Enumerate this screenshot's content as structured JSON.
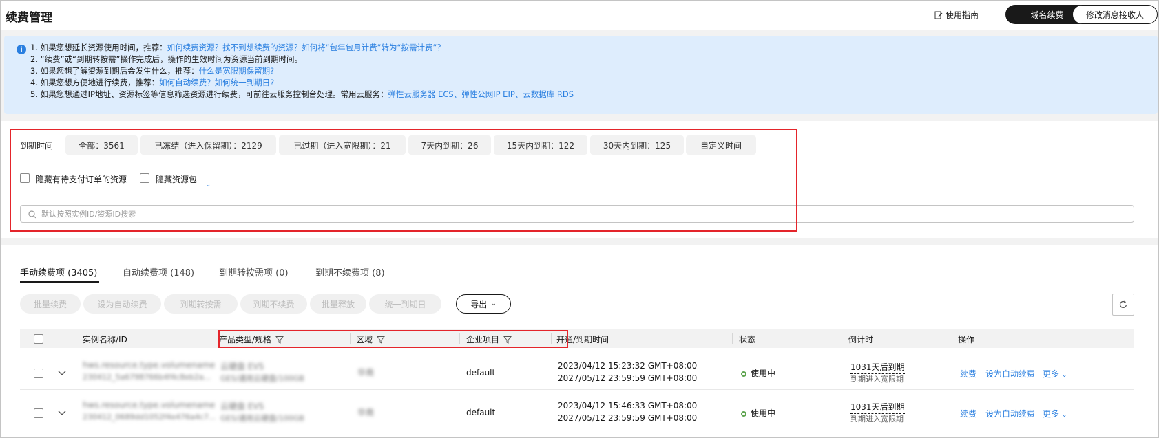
{
  "header": {
    "title": "续费管理",
    "guide_label": "使用指南",
    "domain_renew_label": "域名续费",
    "modify_receiver_label": "修改消息接收人"
  },
  "tips": [
    {
      "text": "1. 如果您想延长资源使用时间，推荐：",
      "link": "如何续费资源？找不到想续费的资源？如何将“包年包月计费”转为“按需计费”？"
    },
    {
      "text": "2. “续费”或“到期转按需”操作完成后，操作的生效时间为资源当前到期时间。",
      "link": ""
    },
    {
      "text": "3. 如果您想了解资源到期后会发生什么，推荐：",
      "link": "什么是宽限期保留期?"
    },
    {
      "text": "4. 如果您想方便地进行续费，推荐：",
      "link": "如何自动续费？如何统一到期日?"
    },
    {
      "text": "5. 如果您想通过IP地址、资源标签等信息筛选资源进行续费，可前往云服务控制台处理。常用云服务：",
      "link": "弹性云服务器 ECS、弹性公网IP EIP、云数据库 RDS"
    }
  ],
  "filter": {
    "label": "到期时间",
    "chips": [
      "全部：3561",
      "已冻结（进入保留期）：2129",
      "已过期（进入宽限期）：21",
      "7天内到期：26",
      "15天内到期：122",
      "30天内到期：125",
      "自定义时间"
    ],
    "hide_pending_label": "隐藏有待支付订单的资源",
    "hide_package_label": "隐藏资源包",
    "search_placeholder": "默认按照实例ID/资源ID搜索"
  },
  "tabs": [
    "手动续费项 (3405)",
    "自动续费项 (148)",
    "到期转按需项 (0)",
    "到期不续费项 (8)"
  ],
  "actions": {
    "buttons": [
      "批量续费",
      "设为自动续费",
      "到期转按需",
      "到期不续费",
      "批量释放",
      "统一到期日"
    ],
    "export_label": "导出"
  },
  "table": {
    "columns": [
      "实例名称/ID",
      "产品类型/规格",
      "区域",
      "企业项目",
      "开通/到期时间",
      "状态",
      "倒计时",
      "操作"
    ],
    "rows": [
      {
        "name": "hws.resource.type.volumename",
        "id": "230412_5a6798766b4f4c8eb2a...",
        "product": "云硬盘 EVS",
        "spec": "GES/通用云硬盘/100GB",
        "region": "华南",
        "project": "default",
        "opened": "2023/04/12 15:23:32 GMT+08:00",
        "expires": "2027/05/12 23:59:59 GMT+08:00",
        "status": "使用中",
        "countdown": "1031天后到期",
        "countdown_sub": "到期进入宽限期",
        "op_renew": "续费",
        "op_auto": "设为自动续费",
        "op_more": "更多"
      },
      {
        "name": "hws.resource.type.volumename",
        "id": "230412_0689dd1052f4e476a4c7...",
        "product": "云硬盘 EVS",
        "spec": "GES/通用云硬盘/100GB",
        "region": "华南",
        "project": "default",
        "opened": "2023/04/12 15:46:33 GMT+08:00",
        "expires": "2027/05/12 23:59:59 GMT+08:00",
        "status": "使用中",
        "countdown": "1031天后到期",
        "countdown_sub": "到期进入宽限期",
        "op_renew": "续费",
        "op_auto": "设为自动续费",
        "op_more": "更多"
      }
    ]
  },
  "colors": {
    "accent": "#2a7fe0",
    "primary_dark": "#191919",
    "highlight_red": "#e4252b",
    "status_green": "#5ca34d",
    "tip_bg": "#deedfd"
  }
}
